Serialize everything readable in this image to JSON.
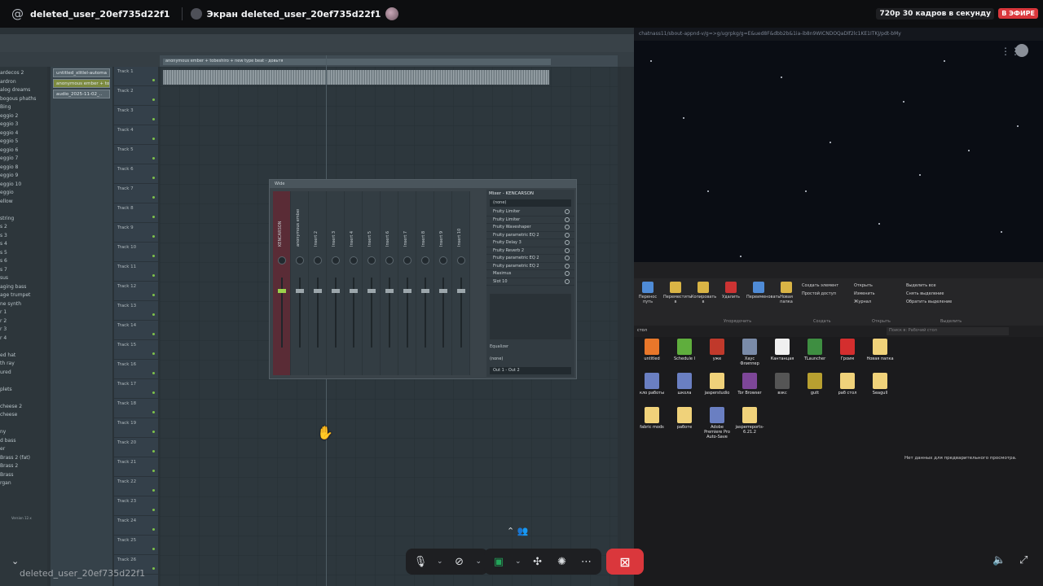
{
  "header": {
    "user_name": "deleted_user_20ef735d22f1",
    "screen_title": "Экран deleted_user_20ef735d22f1",
    "quality": "720p 30 кадров в секунду",
    "live_badge": "В ЭФИРЕ"
  },
  "fl": {
    "browser_items": [
      "ardecos 2",
      "ardron",
      "alog dreams",
      "bogous phaths",
      "Bing",
      "eggio 2",
      "eggio 3",
      "eggio 4",
      "eggio 5",
      "eggio 6",
      "eggio 7",
      "eggio 8",
      "eggio 9",
      "eggio 10",
      "eggio",
      "ellow",
      "",
      "string",
      "s 2",
      "s 3",
      "s 4",
      "s 5",
      "s 6",
      "s 7",
      "sus",
      "aging bass",
      "age trumpet",
      "ne synth",
      "r 1",
      "r 2",
      "r 3",
      "r 4",
      "",
      "ed hat",
      "th ray",
      "ured",
      "",
      "plets",
      "",
      "cheese 2",
      "cheese",
      "",
      "ny",
      "d bass",
      "er",
      "Brass 2 (fat)",
      "Brass 2",
      "Brass",
      "rgan"
    ],
    "picker_items": [
      {
        "label": "untitled_xlitlel-automa",
        "selected": false
      },
      {
        "label": "anonymous ember + tob..",
        "selected": true
      },
      {
        "label": "audio_2025-11-02_..",
        "selected": false
      }
    ],
    "tracks": [
      "Track 1",
      "Track 2",
      "Track 3",
      "Track 4",
      "Track 5",
      "Track 6",
      "Track 7",
      "Track 8",
      "Track 9",
      "Track 10",
      "Track 11",
      "Track 12",
      "Track 13",
      "Track 14",
      "Track 15",
      "Track 16",
      "Track 17",
      "Track 18",
      "Track 19",
      "Track 20",
      "Track 21",
      "Track 22",
      "Track 23",
      "Track 24",
      "Track 25",
      "Track 26"
    ],
    "clip_title": "anonymous ember + tobeshiro + new type beat - довьтя",
    "status_text": "Version 12.x"
  },
  "mixer": {
    "title_bar": "Wide",
    "slots_title": "Mixer - KENCARSON",
    "none_label": "(none)",
    "strips": [
      "KENCARSON",
      "anonymous ember",
      "Insert 2",
      "Insert 3",
      "Insert 4",
      "Insert 5",
      "Insert 6",
      "Insert 7",
      "Insert 8",
      "Insert 9",
      "Insert 10"
    ],
    "effects": [
      "Fruity Limiter",
      "Fruity Limiter",
      "Fruity Waveshaper",
      "Fruity parametric EQ 2",
      "Fruity Delay 3",
      "Fruity Reverb 2",
      "Fruity parametric EQ 2",
      "Fruity parametric EQ 2",
      "Maximus",
      "Slot 10"
    ],
    "equalizer_label": "Equalizer",
    "none_label_2": "(none)",
    "output": "Out 1 - Out 2"
  },
  "desk": {
    "url": "chatnass11/sbout-appnd-v/g=>g/ugrpkg/g=E&ued8F&dbb2b&1ia-ib8n9WICNDOQaDlf2lc1KE1ITKJ/pdt-bMy",
    "ribbon": [
      {
        "label": "Перенос путь"
      },
      {
        "label": "Переместить в"
      },
      {
        "label": "Копировать в"
      },
      {
        "label": "Удалить"
      },
      {
        "label": "Переименовать"
      },
      {
        "label": "Новая папка"
      }
    ],
    "ribbon_create": [
      "Создать элемент",
      "Простой доступ"
    ],
    "ribbon_open": [
      "Открыть",
      "Изменить",
      "Журнал"
    ],
    "ribbon_select": [
      "Выделить все",
      "Снять выделение",
      "Обратить выделение"
    ],
    "groups": {
      "organize": "Упорядочить",
      "create": "Создать",
      "open": "Открыть",
      "select": "Выделить",
      "props": "Свойства"
    },
    "address": "стол",
    "search_placeholder": "Поиск в: Рабочий стол",
    "files": [
      {
        "label": "untitled",
        "color": "#e8772a"
      },
      {
        "label": "Schedule I",
        "color": "#5fae3d"
      },
      {
        "label": "уже",
        "color": "#c0392b"
      },
      {
        "label": "Хаус Флиппер",
        "color": "#7a8ba8"
      },
      {
        "label": "Кантанцая",
        "color": "#f0f0f0"
      },
      {
        "label": "TLauncher",
        "color": "#3e8e41"
      },
      {
        "label": "Гроим",
        "color": "#d42e2e"
      },
      {
        "label": "Новая папка",
        "color": "#f0d27a"
      },
      {
        "label": "кло работы",
        "color": "#6a7fc2"
      },
      {
        "label": "школа",
        "color": "#6a7fc2"
      },
      {
        "label": "jasperstudio",
        "color": "#f0d27a"
      },
      {
        "label": "Tor Browser",
        "color": "#7d4698"
      },
      {
        "label": "взкс",
        "color": "#555"
      },
      {
        "label": "gutt",
        "color": "#b8a030"
      },
      {
        "label": "раб стол",
        "color": "#f0d27a"
      },
      {
        "label": "Seagull",
        "color": "#f0d27a"
      },
      {
        "label": "fabric mods",
        "color": "#f0d27a"
      },
      {
        "label": "работе",
        "color": "#f0d27a"
      },
      {
        "label": "Adobe Premiere Pro Auto-Save",
        "color": "#6a7fc2"
      },
      {
        "label": "jasperreports-6.21.2",
        "color": "#f0d27a"
      }
    ],
    "no_preview": "Нет данных для предварительного просмотра."
  },
  "footer": {
    "stream_name": "deleted_user_20ef735d22f1"
  }
}
